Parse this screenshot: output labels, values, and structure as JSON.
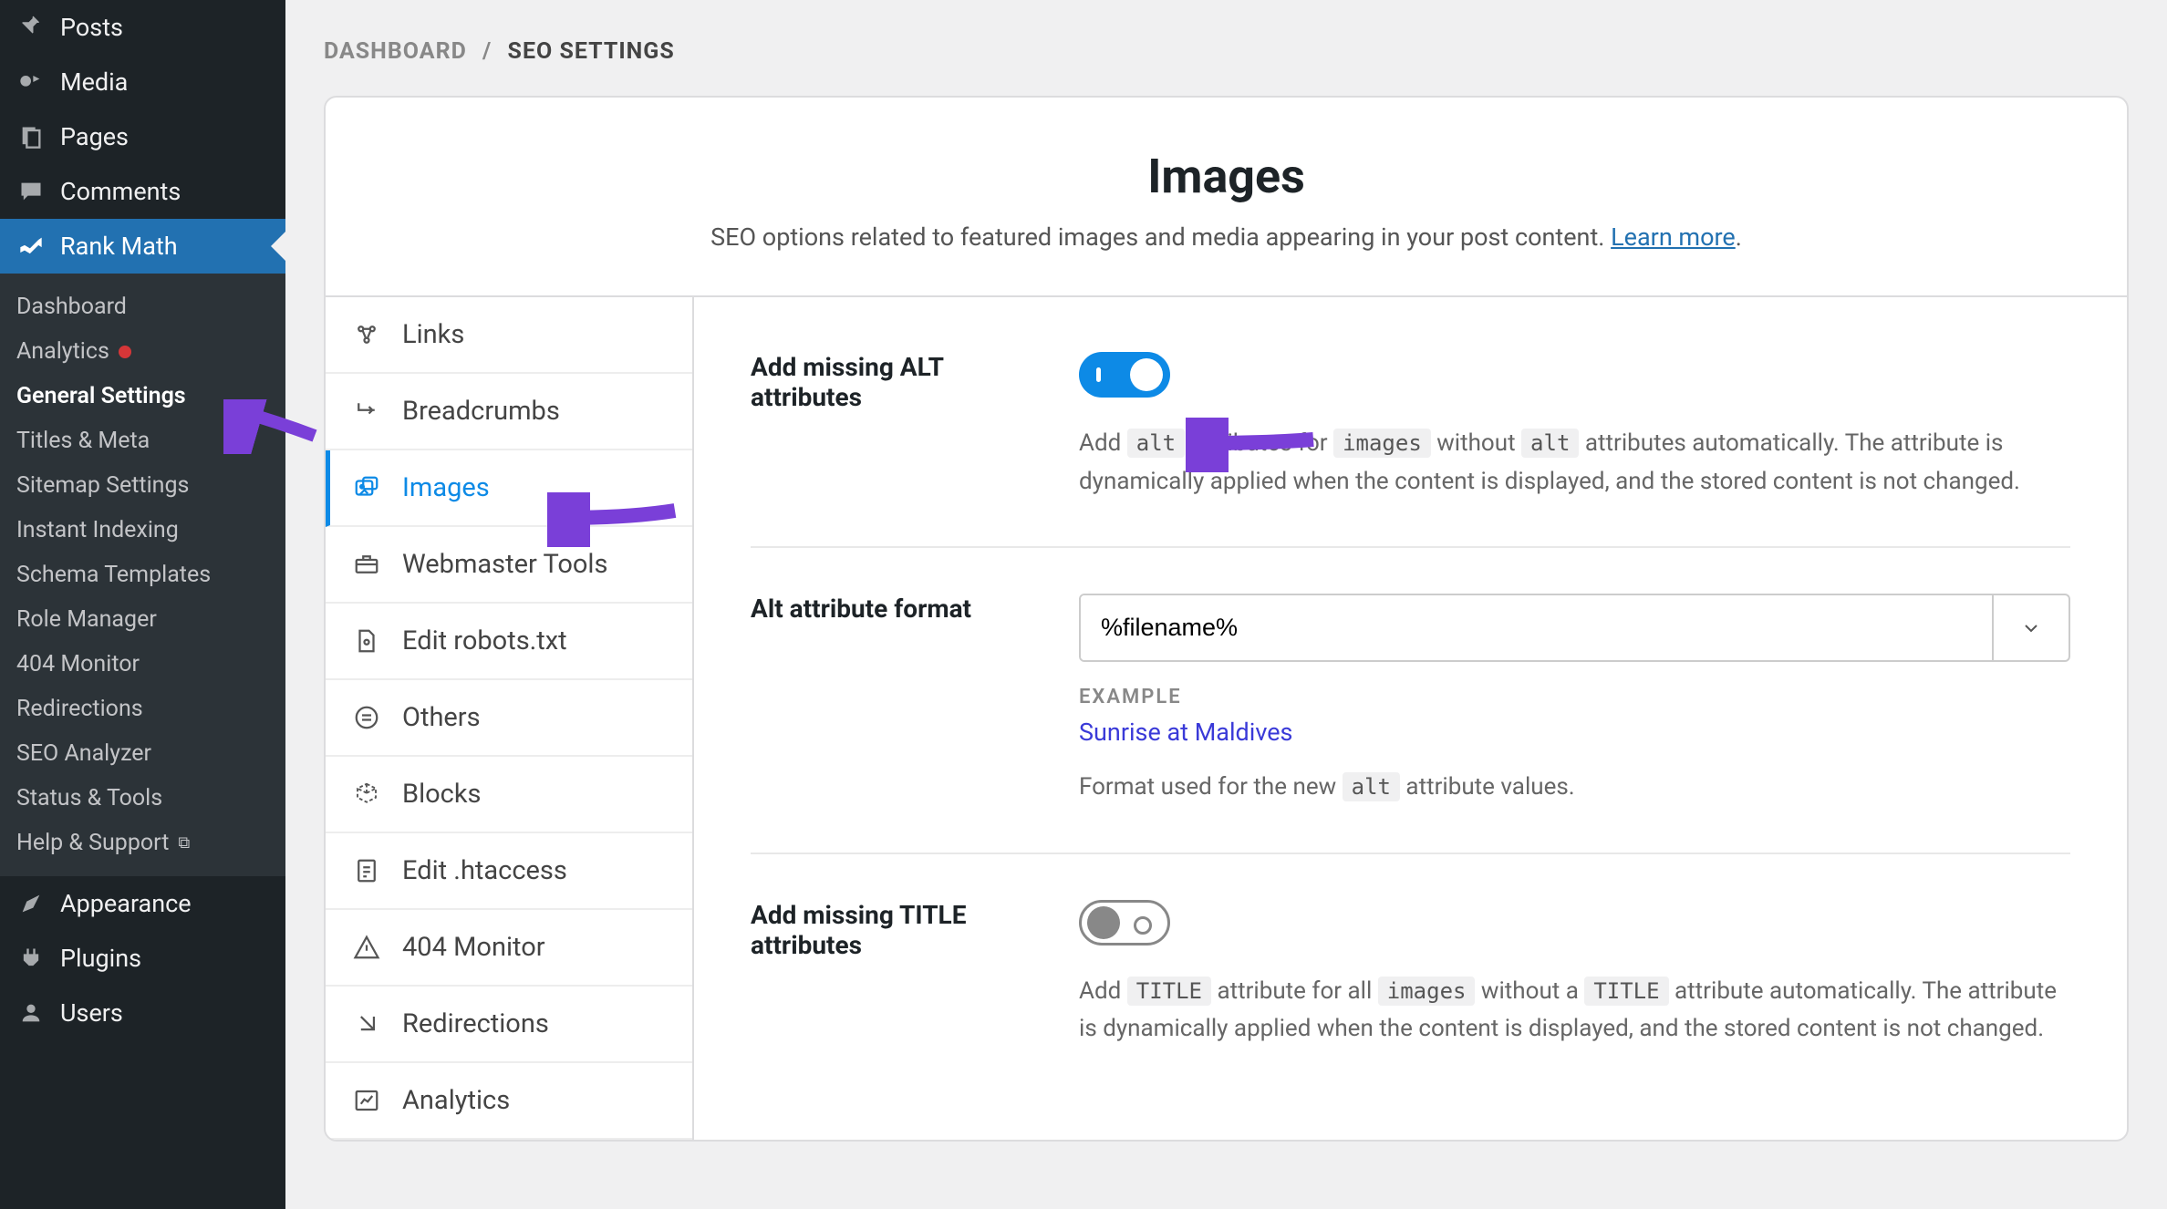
{
  "sidebar": {
    "items": [
      {
        "icon": "pin",
        "label": "Posts"
      },
      {
        "icon": "media",
        "label": "Media"
      },
      {
        "icon": "page",
        "label": "Pages"
      },
      {
        "icon": "comment",
        "label": "Comments"
      },
      {
        "icon": "rankmath",
        "label": "Rank Math",
        "active": true
      },
      {
        "icon": "appearance",
        "label": "Appearance"
      },
      {
        "icon": "plugin",
        "label": "Plugins"
      },
      {
        "icon": "users",
        "label": "Users"
      }
    ],
    "submenu": [
      {
        "label": "Dashboard"
      },
      {
        "label": "Analytics",
        "dot": true
      },
      {
        "label": "General Settings",
        "selected": true
      },
      {
        "label": "Titles & Meta"
      },
      {
        "label": "Sitemap Settings"
      },
      {
        "label": "Instant Indexing"
      },
      {
        "label": "Schema Templates"
      },
      {
        "label": "Role Manager"
      },
      {
        "label": "404 Monitor"
      },
      {
        "label": "Redirections"
      },
      {
        "label": "SEO Analyzer"
      },
      {
        "label": "Status & Tools"
      },
      {
        "label": "Help & Support",
        "external": true
      }
    ]
  },
  "breadcrumb": {
    "parent": "DASHBOARD",
    "sep": "/",
    "current": "SEO SETTINGS"
  },
  "header": {
    "title": "Images",
    "subtitle_pre": "SEO options related to featured images and media appearing in your post content. ",
    "learn_more": "Learn more",
    "period": "."
  },
  "settings_nav": [
    {
      "icon": "links",
      "label": "Links"
    },
    {
      "icon": "breadcrumbs",
      "label": "Breadcrumbs"
    },
    {
      "icon": "images",
      "label": "Images",
      "active": true
    },
    {
      "icon": "toolbox",
      "label": "Webmaster Tools"
    },
    {
      "icon": "robots",
      "label": "Edit robots.txt"
    },
    {
      "icon": "others",
      "label": "Others"
    },
    {
      "icon": "blocks",
      "label": "Blocks"
    },
    {
      "icon": "htaccess",
      "label": "Edit .htaccess"
    },
    {
      "icon": "404",
      "label": "404 Monitor"
    },
    {
      "icon": "redirections",
      "label": "Redirections"
    },
    {
      "icon": "analytics",
      "label": "Analytics"
    }
  ],
  "settings": {
    "add_alt": {
      "label": "Add missing ALT attributes",
      "on": true,
      "desc_parts": [
        "Add ",
        "alt",
        " attributes for ",
        "images",
        " without ",
        "alt",
        " attributes automatically. The attribute is dynamically applied when the content is displayed, and the stored content is not changed."
      ]
    },
    "alt_format": {
      "label": "Alt attribute format",
      "value": "%filename%",
      "example_label": "EXAMPLE",
      "example_value": "Sunrise at Maldives",
      "desc_parts": [
        "Format used for the new ",
        "alt",
        " attribute values."
      ]
    },
    "add_title": {
      "label": "Add missing TITLE attributes",
      "on": false,
      "desc_parts": [
        "Add ",
        "TITLE",
        " attribute for all ",
        "images",
        " without a ",
        "TITLE",
        " attribute automatically. The attribute is dynamically applied when the content is displayed, and the stored content is not changed."
      ]
    }
  },
  "colors": {
    "accent": "#0d8ae6",
    "annotation": "#7a3fd8"
  }
}
